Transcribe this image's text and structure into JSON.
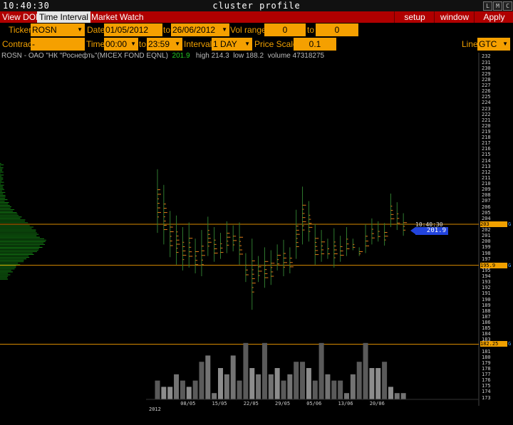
{
  "window": {
    "clock": "10:40:30",
    "title": "cluster profile",
    "buttons": [
      "L",
      "M",
      "C"
    ]
  },
  "menu": {
    "items": [
      {
        "label": "View DOM",
        "active": false
      },
      {
        "label": "Time Interval",
        "active": true
      },
      {
        "label": "Market Watch",
        "active": false
      }
    ],
    "right": [
      "setup",
      "window",
      "Apply"
    ]
  },
  "params": {
    "ticker_label": "Ticker",
    "ticker": "ROSN",
    "date_label": "Date",
    "date_from": "01/05/2012",
    "date_to_label": "to",
    "date_to": "26/06/2012",
    "vol_range_label": "Vol range",
    "vol_from": "0",
    "vol_to_label": "to",
    "vol_to": "0",
    "contract_label": "Contract",
    "contract": "-",
    "time_label": "Time",
    "time_from": "00:00",
    "time_to_label": "to",
    "time_to": "23:59",
    "interval_label": "Interval",
    "interval": "1 DAY",
    "price_scale_label": "Price Scale",
    "price_scale": "0.1",
    "line_label": "Line",
    "line": "GTC"
  },
  "info": {
    "symbol": "ROSN",
    "separator": "-",
    "name": "ОАО \"НК \"Роснефть\"(MICEX FOND EQNL)",
    "last": "201.9",
    "high_label": "high",
    "high": "214.3",
    "low_label": "low",
    "low": "188.2",
    "volume_label": "volume",
    "volume": "47318275"
  },
  "chart_data": {
    "type": "cluster",
    "y_range": [
      172.7,
      232.3
    ],
    "y_ticks": [
      232,
      231,
      230,
      229,
      228,
      227,
      226,
      225,
      224,
      223,
      222,
      221,
      220,
      219,
      218,
      217,
      216,
      215,
      214,
      213,
      212,
      211,
      210,
      209,
      208,
      207,
      206,
      205,
      204,
      203,
      202,
      201,
      200,
      199,
      198,
      197,
      196,
      195,
      194,
      193,
      192,
      191,
      190,
      189,
      188,
      187,
      186,
      185,
      184,
      183,
      182,
      181,
      180,
      179,
      178,
      177,
      176,
      175,
      174,
      173
    ],
    "marked_levels": [
      {
        "price": 203.0,
        "label": "203"
      },
      {
        "price": 195.9,
        "label": "195.9"
      },
      {
        "price": 182.25,
        "label": "182.25"
      }
    ],
    "x_ticks": [
      {
        "label": "2012",
        "index": 0
      },
      {
        "label": "08/05",
        "index": 5
      },
      {
        "label": "15/05",
        "index": 10
      },
      {
        "label": "22/05",
        "index": 15
      },
      {
        "label": "29/05",
        "index": 20
      },
      {
        "label": "05/06",
        "index": 25
      },
      {
        "label": "13/06",
        "index": 30
      },
      {
        "label": "20/06",
        "index": 35
      }
    ],
    "current_time": "10:40:30",
    "current_price": "201.9",
    "candles": [
      {
        "high": 212.5,
        "low": 201.5
      },
      {
        "high": 209.8,
        "low": 199.5
      },
      {
        "high": 205.3,
        "low": 197.3
      },
      {
        "high": 204.5,
        "low": 196.0
      },
      {
        "high": 202.5,
        "low": 195.0
      },
      {
        "high": 203.3,
        "low": 195.5
      },
      {
        "high": 200.5,
        "low": 194.5
      },
      {
        "high": 202.0,
        "low": 194.0
      },
      {
        "high": 204.3,
        "low": 197.5
      },
      {
        "high": 202.5,
        "low": 196.5
      },
      {
        "high": 201.5,
        "low": 197.0
      },
      {
        "high": 203.5,
        "low": 198.0
      },
      {
        "high": 202.8,
        "low": 198.3
      },
      {
        "high": 203.3,
        "low": 196.0
      },
      {
        "high": 198.0,
        "low": 193.0
      },
      {
        "high": 200.5,
        "low": 188.2
      },
      {
        "high": 197.5,
        "low": 193.0
      },
      {
        "high": 199.0,
        "low": 192.0
      },
      {
        "high": 198.5,
        "low": 192.5
      },
      {
        "high": 199.5,
        "low": 195.0
      },
      {
        "high": 200.3,
        "low": 194.0
      },
      {
        "high": 199.0,
        "low": 194.5
      },
      {
        "high": 205.5,
        "low": 197.0
      },
      {
        "high": 209.5,
        "low": 199.5
      },
      {
        "high": 207.0,
        "low": 200.0
      },
      {
        "high": 203.0,
        "low": 196.0
      },
      {
        "high": 202.0,
        "low": 196.5
      },
      {
        "high": 200.5,
        "low": 197.0
      },
      {
        "high": 202.3,
        "low": 195.5
      },
      {
        "high": 201.0,
        "low": 196.5
      },
      {
        "high": 202.5,
        "low": 197.5
      },
      {
        "high": 200.5,
        "low": 198.5
      },
      {
        "high": 199.0,
        "low": 197.5
      },
      {
        "high": 203.0,
        "low": 198.0
      },
      {
        "high": 204.0,
        "low": 199.5
      },
      {
        "high": 203.5,
        "low": 200.0
      },
      {
        "high": 203.2,
        "low": 199.3
      },
      {
        "high": 208.3,
        "low": 202.5
      },
      {
        "high": 206.8,
        "low": 202.0
      },
      {
        "high": 204.9,
        "low": 201.0
      }
    ],
    "volumes": [
      3,
      2,
      2,
      4,
      3,
      2,
      3,
      6,
      7,
      1,
      5,
      4,
      7,
      3,
      9,
      5,
      4,
      9,
      4,
      5,
      3,
      4,
      6,
      6,
      5,
      3,
      9,
      4,
      3,
      3,
      1,
      4,
      6,
      9,
      5,
      5,
      6,
      2,
      1,
      1
    ]
  }
}
